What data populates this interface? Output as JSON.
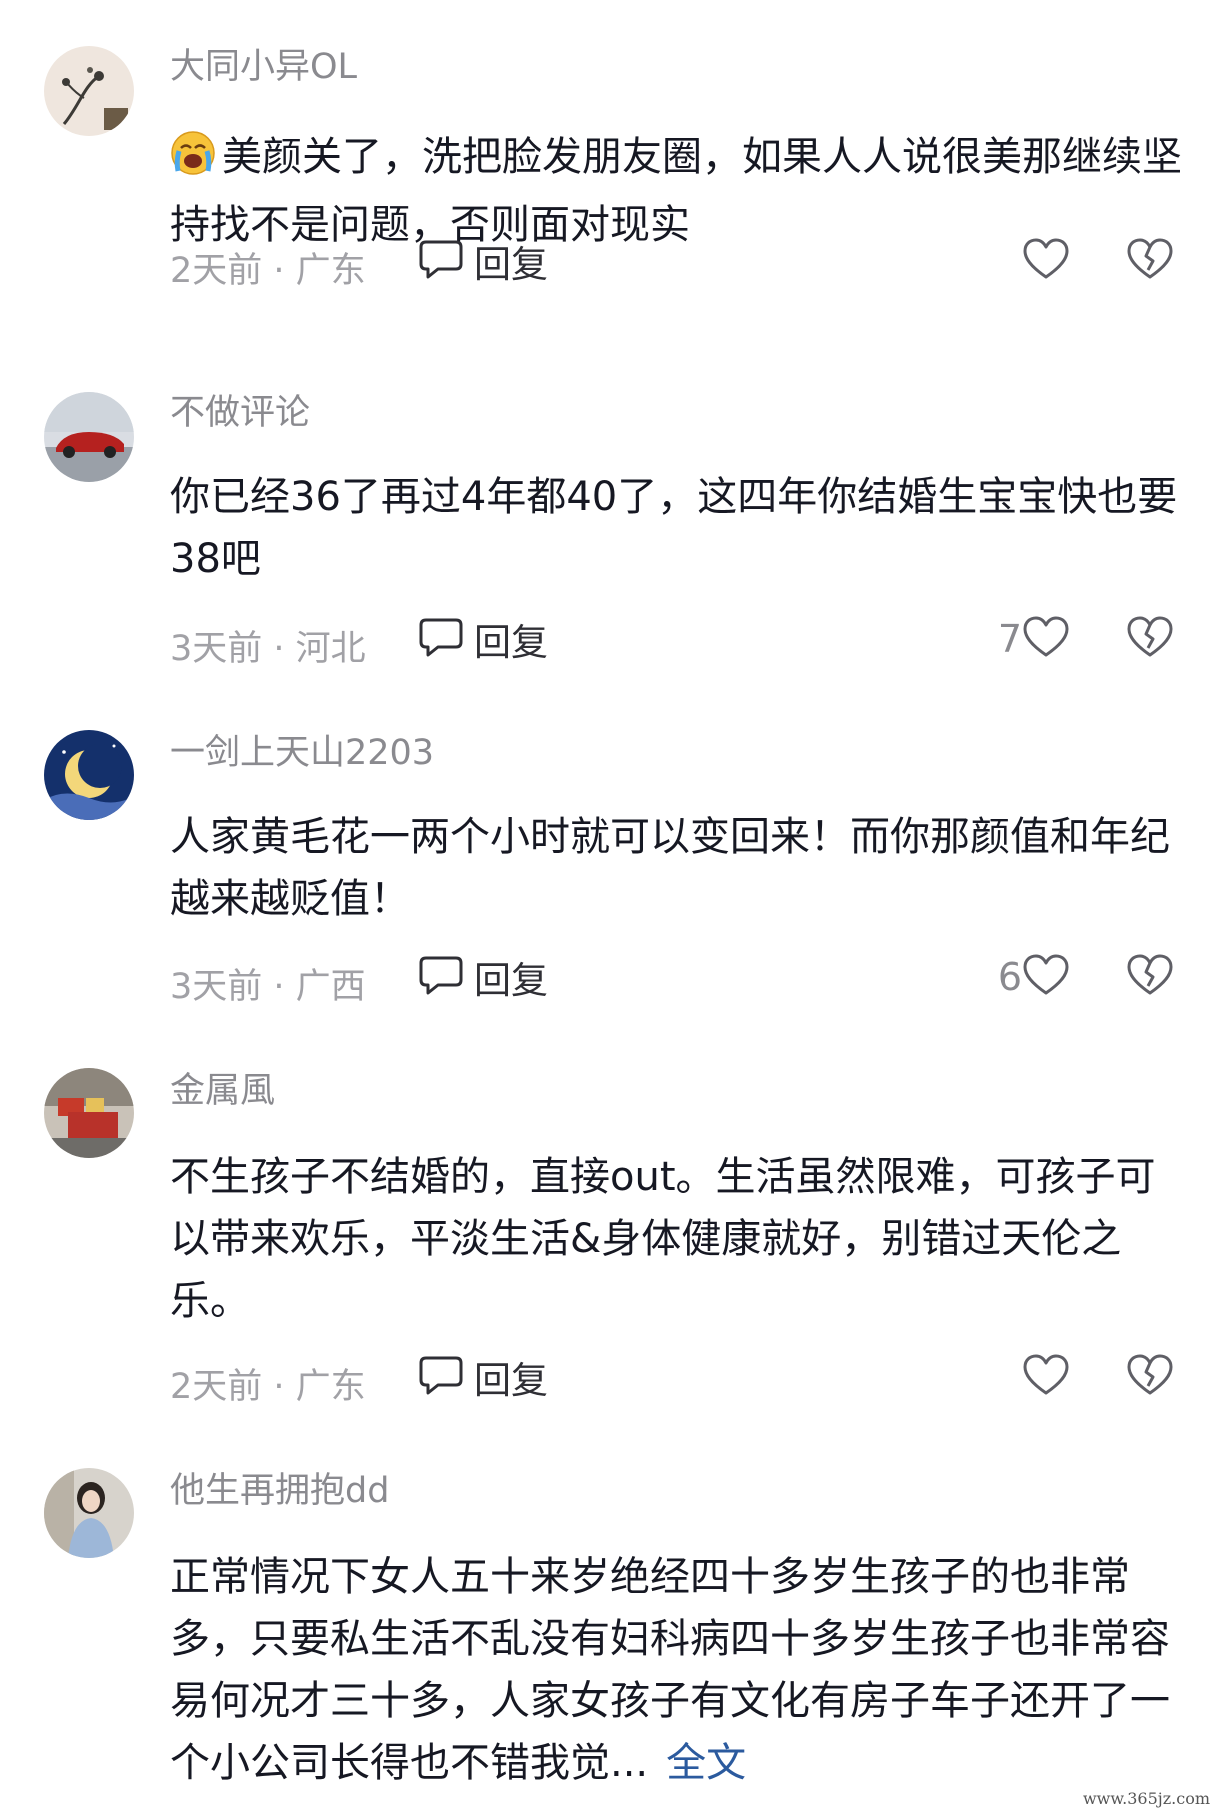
{
  "comments": [
    {
      "username": "大同小异OL",
      "emoji": "crying-face-emoji",
      "text": "美颜关了，洗把脸发朋友圈，如果人人说很美那继续坚持找不是问题，否则面对现实",
      "time_location": "2天前 · 广东",
      "reply_label": "回复",
      "likes": ""
    },
    {
      "username": "不做评论",
      "text": "你已经36了再过4年都40了，这四年你结婚生宝宝快也要38吧",
      "time_location": "3天前 · 河北",
      "reply_label": "回复",
      "likes": "7"
    },
    {
      "username": "一剑上天山2203",
      "text": "人家黄毛花一两个小时就可以变回来！而你那颜值和年纪越来越贬值！",
      "time_location": "3天前 · 广西",
      "reply_label": "回复",
      "likes": "6"
    },
    {
      "username": "金属風",
      "text": "不生孩子不结婚的，直接out。生活虽然限难，可孩子可以带来欢乐，平淡生活&身体健康就好，别错过天伦之乐。",
      "time_location": "2天前 · 广东",
      "reply_label": "回复",
      "likes": ""
    },
    {
      "username": "他生再拥抱dd",
      "text": "正常情况下女人五十来岁绝经四十多岁生孩子的也非常多，只要私生活不乱没有妇科病四十多岁生孩子也非常容易何况才三十多，人家女孩子有文化有房子车子还开了一个小公司长得也不错我觉...",
      "more_label": "全文"
    }
  ],
  "watermark": "www.365jz.com"
}
